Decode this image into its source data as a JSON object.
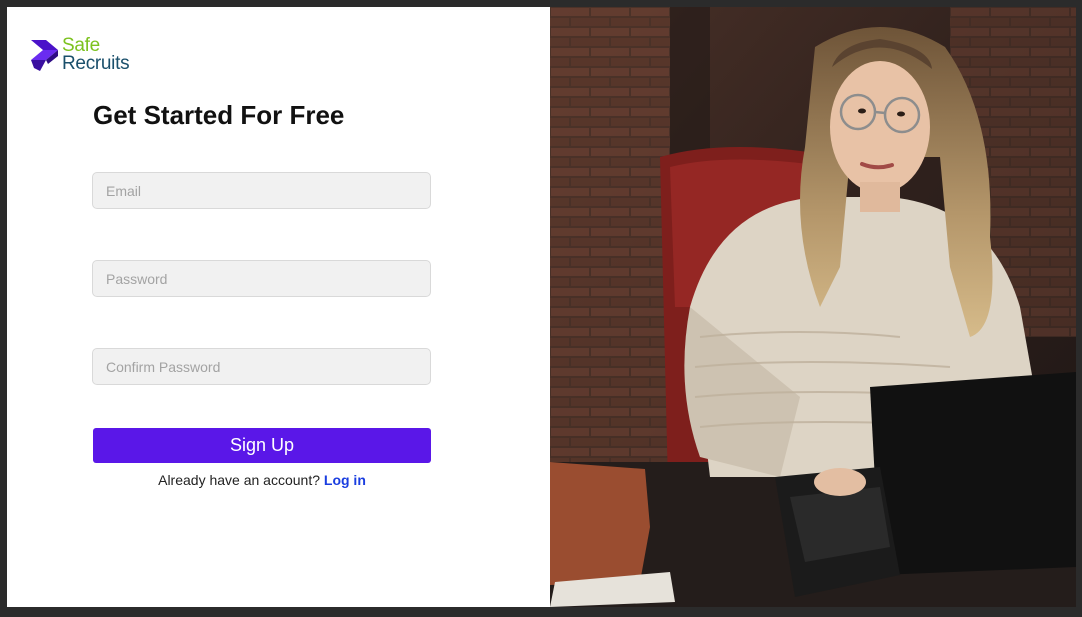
{
  "brand": {
    "name_line1": "Safe",
    "name_line2": "Recruits",
    "logo_icon": "safe-recruits-logo-icon",
    "colors": {
      "safe": "#7cc21f",
      "recruits": "#1a4f6b",
      "logo_mark": "#5a17e8"
    }
  },
  "form": {
    "title": "Get Started For Free",
    "email": {
      "placeholder": "Email",
      "value": ""
    },
    "password": {
      "placeholder": "Password",
      "value": ""
    },
    "confirm_password": {
      "placeholder": "Confirm Password",
      "value": ""
    },
    "submit_label": "Sign Up",
    "login_prompt": "Already have an account?",
    "login_link": "Log in",
    "colors": {
      "button": "#5a17e8",
      "link": "#1a3ee0"
    }
  },
  "hero": {
    "image_subject": "woman-with-laptop-photo"
  }
}
